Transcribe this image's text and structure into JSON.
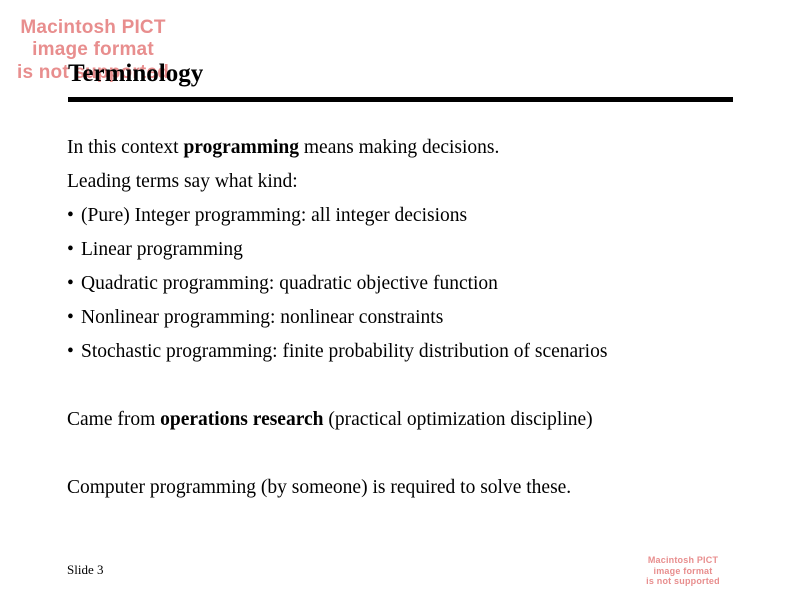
{
  "slide": {
    "title": "Terminology",
    "footer_label": "Slide 3",
    "accent_color": "#e88e8e",
    "text_color": "#000000",
    "background_color": "#ffffff"
  },
  "pict_placeholder": {
    "line1": "Macintosh PICT",
    "line2": "image format",
    "line3": "is not supported"
  },
  "body": {
    "intro_line": {
      "part1": "In this context ",
      "bold": "programming",
      "part2": " means making decisions."
    },
    "lead_line": "Leading terms say what kind:",
    "bullet_mark": "•",
    "bullets": [
      "(Pure) Integer programming: all integer decisions",
      "Linear programming",
      "Quadratic programming: quadratic objective function",
      "Nonlinear programming: nonlinear constraints",
      "Stochastic programming: finite probability distribution of scenarios"
    ],
    "origin_line": {
      "part1": "Came from ",
      "bold": "operations research",
      "part2": " (practical optimization discipline)"
    },
    "closing_line": "Computer programming (by someone) is required to solve these."
  }
}
